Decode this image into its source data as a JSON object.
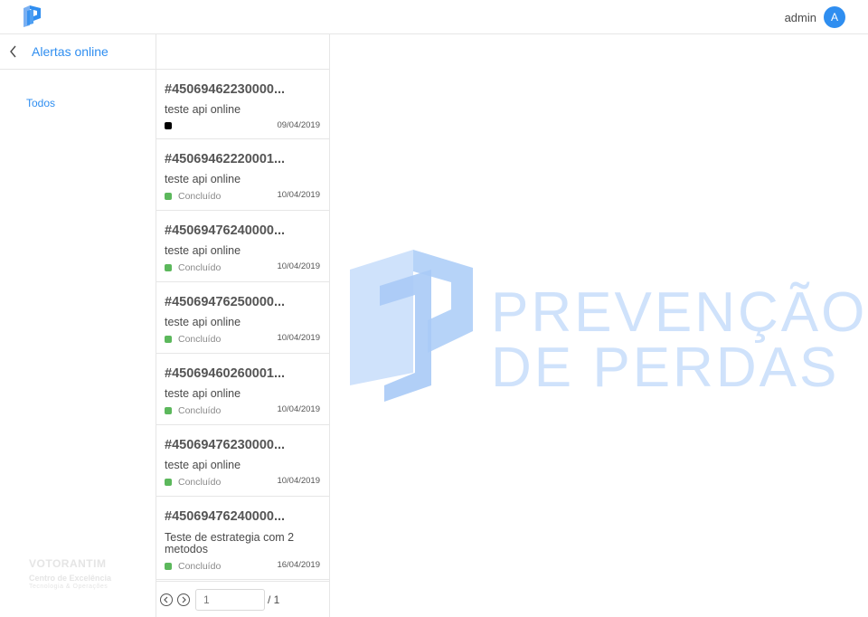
{
  "header": {
    "user_name": "admin",
    "avatar_initial": "A"
  },
  "sidebar": {
    "title": "Alertas online",
    "filters": [
      {
        "label": "Todos"
      }
    ],
    "brand": {
      "name": "VOTORANTIM",
      "line1": "Centro de Excelência",
      "line2": "Tecnologia & Operações"
    }
  },
  "alerts": [
    {
      "id": "#45069462230000...",
      "description": "teste api online",
      "status": "",
      "status_color": "#000000",
      "date": "09/04/2019"
    },
    {
      "id": "#45069462220001...",
      "description": "teste api online",
      "status": "Concluído",
      "status_color": "#5cb85c",
      "date": "10/04/2019"
    },
    {
      "id": "#45069476240000...",
      "description": "teste api online",
      "status": "Concluído",
      "status_color": "#5cb85c",
      "date": "10/04/2019"
    },
    {
      "id": "#45069476250000...",
      "description": "teste api online",
      "status": "Concluído",
      "status_color": "#5cb85c",
      "date": "10/04/2019"
    },
    {
      "id": "#45069460260001...",
      "description": "teste api online",
      "status": "Concluído",
      "status_color": "#5cb85c",
      "date": "10/04/2019"
    },
    {
      "id": "#45069476230000...",
      "description": "teste api online",
      "status": "Concluído",
      "status_color": "#5cb85c",
      "date": "10/04/2019"
    },
    {
      "id": "#45069476240000...",
      "description": "Teste de estrategia com 2 metodos",
      "status": "Concluído",
      "status_color": "#5cb85c",
      "date": "16/04/2019"
    }
  ],
  "pagination": {
    "page_placeholder": "1",
    "total": "/ 1"
  },
  "watermark": {
    "line1": "PREVENÇÃO",
    "line2": "DE PERDAS"
  },
  "colors": {
    "accent": "#2f8ef0",
    "watermark": "#cfe2fb",
    "success": "#5cb85c"
  },
  "icons": {
    "logo": "logo-icon",
    "back": "chevron-left-icon",
    "prev": "circle-chevron-left-icon",
    "next": "circle-chevron-right-icon"
  }
}
